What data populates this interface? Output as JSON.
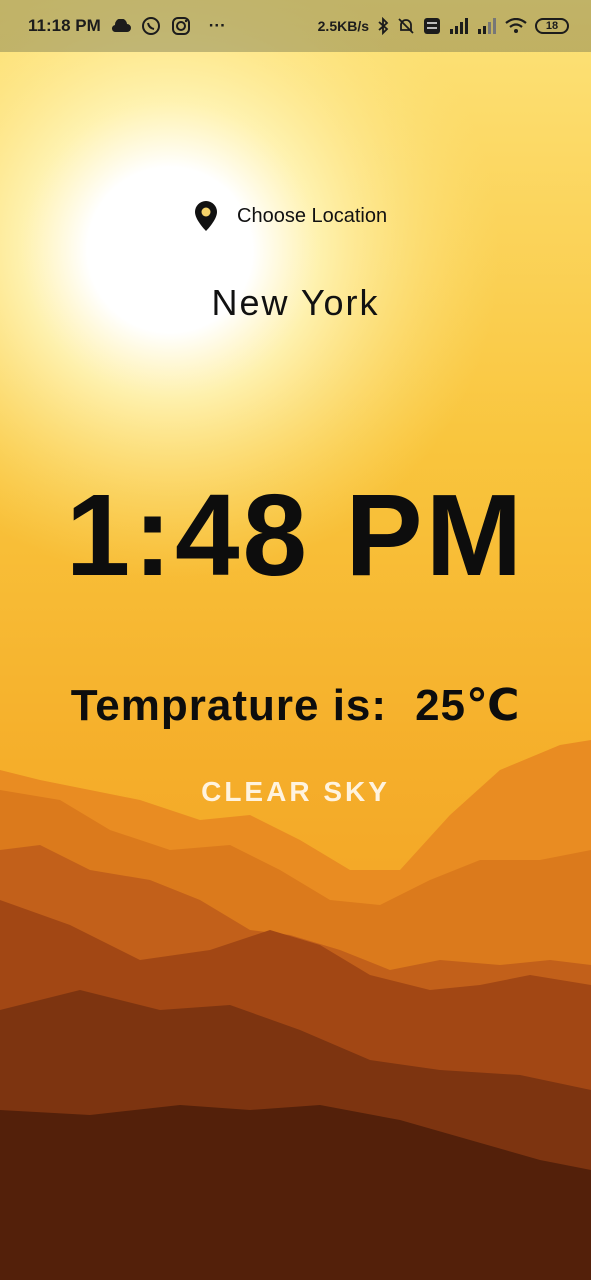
{
  "status_bar": {
    "time": "11:18 PM",
    "more": "···",
    "net_speed": "2.5KB/s",
    "battery": "18",
    "icons": [
      "cloud-icon",
      "whatsapp-icon",
      "instagram-icon",
      "bluetooth-icon",
      "mute-bell-icon",
      "volte-icon",
      "signal-icon",
      "wifi-icon",
      "battery-icon"
    ]
  },
  "location": {
    "choose_label": "Choose Location",
    "city": "New York"
  },
  "clock": {
    "time": "1:48 PM"
  },
  "weather": {
    "temp_label": "Temprature is:",
    "temp_value": "25℃",
    "condition": "CLEAR SKY"
  },
  "colors": {
    "sky_top": "#ffffff",
    "sky_mid": "#f7b52a",
    "sky_low": "#f29a1e",
    "mountain_far": "#e0801c",
    "mountain_mid": "#b9581a",
    "mountain_near": "#6b2a0c",
    "condition_text": "#fff3df"
  }
}
